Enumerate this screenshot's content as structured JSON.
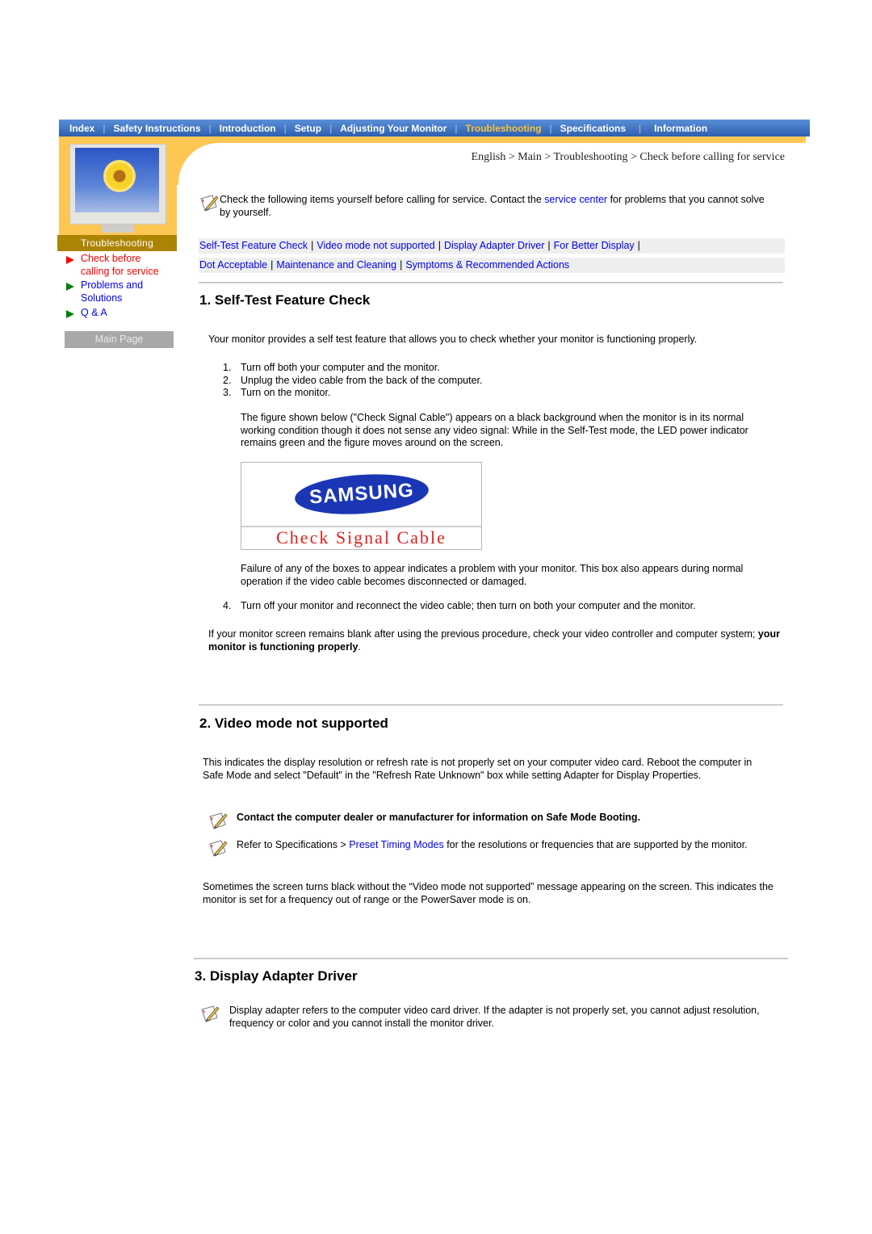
{
  "nav": {
    "items": [
      {
        "label": "Index",
        "active": false
      },
      {
        "label": "Safety Instructions",
        "active": false
      },
      {
        "label": "Introduction",
        "active": false
      },
      {
        "label": "Setup",
        "active": false
      },
      {
        "label": "Adjusting Your Monitor",
        "active": false
      },
      {
        "label": "Troubleshooting",
        "active": true
      },
      {
        "label": "Specifications",
        "active": false
      },
      {
        "label": "Information",
        "active": false
      }
    ],
    "separator": "|"
  },
  "breadcrumb": "English > Main > Troubleshooting > Check before calling for service",
  "sidebar": {
    "header": "Troubleshooting",
    "links": [
      {
        "label": "Check before calling for service",
        "current": true
      },
      {
        "label": "Problems and Solutions",
        "current": false
      },
      {
        "label": "Q & A",
        "current": false
      }
    ],
    "main_page": "Main Page"
  },
  "colors": {
    "nav_blue": "#3a6cbf",
    "active_nav": "#f7c43b",
    "band_yellow": "#fec754",
    "sidebar_header": "#ac8404",
    "link": "#0000ee",
    "current_link": "#ff0000"
  },
  "intro": {
    "icon": "note-pencil-icon",
    "text_before": "Check the following items yourself before calling for service. Contact the ",
    "link": "service center",
    "text_after": " for problems that you cannot solve by yourself."
  },
  "quick_links": {
    "row1": [
      "Self-Test Feature Check",
      "Video mode not supported",
      "Display Adapter Driver",
      "For Better Display"
    ],
    "row2": [
      "Dot Acceptable",
      "Maintenance and Cleaning",
      "Symptoms & Recommended Actions"
    ],
    "separator": "|"
  },
  "section1": {
    "title": "1. Self-Test Feature Check",
    "intro": "Your monitor provides a self test feature that allows you to check whether your monitor is functioning properly.",
    "steps": [
      {
        "num": "1.",
        "text": "Turn off both your computer and the monitor."
      },
      {
        "num": "2.",
        "text": "Unplug the video cable from the back of the computer."
      },
      {
        "num": "3.",
        "text": "Turn on the monitor."
      }
    ],
    "figure_desc": "The figure shown below (\"Check Signal Cable\") appears on a black background when the monitor is in its normal working condition though it does not sense any video signal: While in the Self-Test mode, the LED power indicator remains green and the figure moves around on the screen.",
    "figure": {
      "logo": "SAMSUNG",
      "caption": "Check Signal Cable"
    },
    "failure": "Failure of any of the boxes to appear indicates a problem with your monitor. This box also appears during normal operation if the video cable becomes disconnected or damaged.",
    "step4": {
      "num": "4.",
      "text": "Turn off your monitor and reconnect the video cable; then turn on both your computer and the monitor."
    },
    "closing_before": "If your monitor screen remains blank after using the previous procedure, check your video controller and computer system; ",
    "closing_bold": "your monitor is functioning properly",
    "closing_after": "."
  },
  "section2": {
    "title": "2. Video mode not supported",
    "intro": "This indicates the display resolution or refresh rate is not properly set on your computer video card. Reboot the computer in Safe Mode and select \"Default\" in the \"Refresh Rate Unknown\" box while setting Adapter for Display Properties.",
    "note1": "Contact the computer dealer or manufacturer for information on Safe Mode Booting.",
    "note2_before": "Refer to Specifications > ",
    "note2_link": "Preset Timing Modes",
    "note2_after": " for the resolutions or frequencies that are supported by the monitor.",
    "closing": "Sometimes the screen turns black without the “Video mode not supported” message appearing on the screen. This indicates the monitor is set for a frequency out of range or the PowerSaver mode is on."
  },
  "section3": {
    "title": "3. Display Adapter Driver",
    "note": "Display adapter refers to the computer video card driver. If the adapter is not properly set, you cannot adjust resolution, frequency or color and you cannot install the monitor driver."
  }
}
